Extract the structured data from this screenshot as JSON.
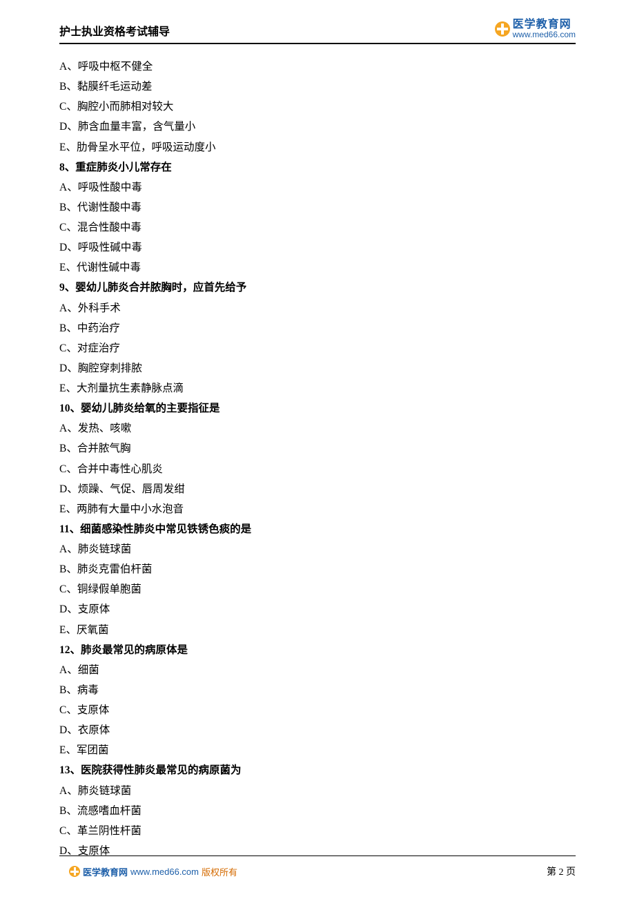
{
  "header": {
    "title": "护士执业资格考试辅导",
    "logo_cn": "医学教育网",
    "logo_url": "www.med66.com"
  },
  "q7_options": {
    "A": "呼吸中枢不健全",
    "B": "黏膜纤毛运动差",
    "C": "胸腔小而肺相对较大",
    "D": "肺含血量丰富，含气量小",
    "E": "肋骨呈水平位，呼吸运动度小"
  },
  "questions": [
    {
      "num": "8",
      "text": "重症肺炎小儿常存在",
      "options": {
        "A": "呼吸性酸中毒",
        "B": "代谢性酸中毒",
        "C": "混合性酸中毒",
        "D": "呼吸性碱中毒",
        "E": "代谢性碱中毒"
      }
    },
    {
      "num": "9",
      "text": "婴幼儿肺炎合并脓胸时，应首先给予",
      "options": {
        "A": "外科手术",
        "B": "中药治疗",
        "C": "对症治疗",
        "D": "胸腔穿刺排脓",
        "E": "大剂量抗生素静脉点滴"
      }
    },
    {
      "num": "10",
      "text": "婴幼儿肺炎给氧的主要指征是",
      "options": {
        "A": "发热、咳嗽",
        "B": "合并脓气胸",
        "C": "合并中毒性心肌炎",
        "D": "烦躁、气促、唇周发绀",
        "E": "两肺有大量中小水泡音"
      }
    },
    {
      "num": "11",
      "text": "细菌感染性肺炎中常见铁锈色痰的是",
      "options": {
        "A": "肺炎链球菌",
        "B": "肺炎克雷伯杆菌",
        "C": "铜绿假单胞菌",
        "D": "支原体",
        "E": "厌氧菌"
      }
    },
    {
      "num": "12",
      "text": "肺炎最常见的病原体是",
      "options": {
        "A": "细菌",
        "B": "病毒",
        "C": "支原体",
        "D": "衣原体",
        "E": "军团菌"
      }
    },
    {
      "num": "13",
      "text": "医院获得性肺炎最常见的病原菌为",
      "options": {
        "A": "肺炎链球菌",
        "B": "流感嗜血杆菌",
        "C": "革兰阴性杆菌",
        "D": "支原体"
      }
    }
  ],
  "footer": {
    "brand": "医学教育网",
    "url": "www.med66.com",
    "copyright": "版权所有",
    "page_prefix": "第 ",
    "page_num": "2",
    "page_suffix": " 页"
  }
}
